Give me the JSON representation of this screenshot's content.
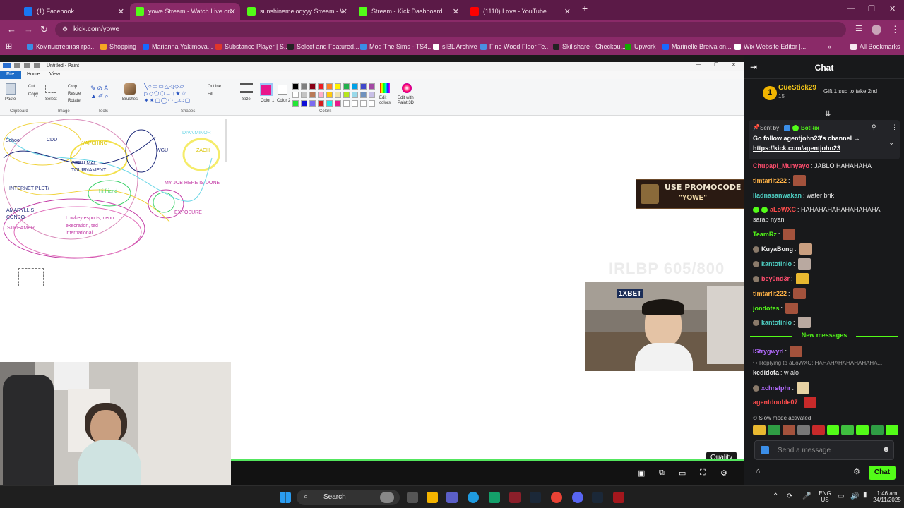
{
  "browser": {
    "tabs": [
      {
        "label": "(1) Facebook",
        "color": "#1877f2",
        "active": false
      },
      {
        "label": "yowe Stream - Watch Live on K",
        "color": "#53fc18",
        "active": true
      },
      {
        "label": "sunshinemelodyyy Stream - W",
        "color": "#53fc18",
        "active": false
      },
      {
        "label": "Stream - Kick Dashboard",
        "color": "#53fc18",
        "active": false
      },
      {
        "label": "(1110) Love - YouTube",
        "color": "#ff0000",
        "active": false
      }
    ],
    "url": "kick.com/yowe",
    "bookmarks": [
      "Компьютерная гра...",
      "Shopping",
      "Marianna Yakimova...",
      "Substance Player | S...",
      "Select and Featured...",
      "Mod The Sims - TS4...",
      "sIBL Archive",
      "Fine Wood Floor Te...",
      "Skillshare - Checkou...",
      "Upwork",
      "Marinelle Breiva on...",
      "Wix Website Editor |..."
    ],
    "all_bookmarks": "All Bookmarks"
  },
  "paint": {
    "title": "Untitled - Paint",
    "menu": {
      "file": "File",
      "home": "Home",
      "view": "View"
    },
    "ribbon": {
      "paste": "Paste",
      "cut": "Cut",
      "copy": "Copy",
      "clipboard": "Clipboard",
      "select": "Select",
      "crop": "Crop",
      "resize": "Resize",
      "rotate": "Rotate",
      "image": "Image",
      "tools": "Tools",
      "brushes": "Brushes",
      "shapes": "Shapes",
      "outline": "Outline",
      "fill": "Fill",
      "size": "Size",
      "color1": "Color 1",
      "color2": "Color 2",
      "colors": "Colors",
      "edit_colors": "Edit colors",
      "edit_paint3d": "Edit with Paint 3D"
    },
    "canvas_labels": [
      {
        "text": "School",
        "color": "#1e2a7a"
      },
      {
        "text": "CDD",
        "color": "#1e2a7a"
      },
      {
        "text": "YAPCHING",
        "color": "#d9c300"
      },
      {
        "text": "CEBU MALL",
        "color": "#1e2a7a"
      },
      {
        "text": "TOURNAMENT",
        "color": "#1e2a7a"
      },
      {
        "text": "WGU",
        "color": "#1e2a7a"
      },
      {
        "text": "ZACH",
        "color": "#d9c300"
      },
      {
        "text": "INTERNET PLDT/",
        "color": "#1e2a7a"
      },
      {
        "text": "Hi friend",
        "color": "#3dd26a"
      },
      {
        "text": "MY JOB HERE IS DONE",
        "color": "#c23aa5"
      },
      {
        "text": "AMARYLLIS",
        "color": "#1e2a7a"
      },
      {
        "text": "CONDO",
        "color": "#1e2a7a"
      },
      {
        "text": "STREAMER",
        "color": "#c23aa5"
      },
      {
        "text": "Lowkey esports, neon",
        "color": "#c23aa5"
      },
      {
        "text": "execration, ted",
        "color": "#c23aa5"
      },
      {
        "text": "international",
        "color": "#c23aa5"
      },
      {
        "text": "EXPOSURE",
        "color": "#c23aa5"
      },
      {
        "text": "DIVA MINOR",
        "color": "#67d5e6"
      }
    ]
  },
  "stream": {
    "promo_line1": "USE PROMOCODE",
    "promo_line2": "\"YOWE\"",
    "watermark": "IRLBP 605/800",
    "sponsor": "1XBET",
    "quality": "Quality",
    "progress": 1.0
  },
  "chat": {
    "title": "Chat",
    "gift": {
      "user": "CueStick29",
      "count": "15",
      "text": "Gift 1 sub to take 2nd"
    },
    "pinned": {
      "sent_by_label": "Sent by",
      "sender": "BotRix",
      "text": "Go follow agentjohn23's channel →",
      "link": "https://kick.com/agentjohn23"
    },
    "messages": [
      {
        "user": "Chupapi_Munyayo",
        "color": "#ff4d6d",
        "text": "JABLO HAHAHAHA",
        "emote": false
      },
      {
        "user": "timtarlit222",
        "color": "#ffb347",
        "text": "",
        "emote": true
      },
      {
        "user": "lladnasanwakan",
        "color": "#4fd1c5",
        "text": "water brik",
        "emote": false
      },
      {
        "user": "aLoWXC",
        "color": "#ff4d4d",
        "text": "HAHAHAHAHAHAHAHAHA",
        "emote": false
      },
      {
        "user": "",
        "color": "#e8e8e8",
        "text": "sarap nyan",
        "emote": false
      },
      {
        "user": "TeamRz",
        "color": "#53fc18",
        "text": "",
        "emote": true
      },
      {
        "user": "KuyaBong",
        "color": "#e8e8e8",
        "text": "",
        "emote": true
      },
      {
        "user": "kantotinio",
        "color": "#4fd1c5",
        "text": "",
        "emote": true
      },
      {
        "user": "bey0nd3r",
        "color": "#ff4d6d",
        "text": "",
        "emote": true
      },
      {
        "user": "timtarlit222",
        "color": "#ffb347",
        "text": "",
        "emote": true
      },
      {
        "user": "jondotes",
        "color": "#53fc18",
        "text": "",
        "emote": true
      },
      {
        "user": "kantotinio",
        "color": "#4fd1c5",
        "text": "",
        "emote": true
      }
    ],
    "new_messages": "New messages",
    "after": [
      {
        "user": "lStrygwyrl",
        "color": "#b36bff",
        "text": "",
        "emote": true
      },
      {
        "user": "",
        "color": "#9a9a9a",
        "text": "Replying to aLoWXC: HAHAHAHAHAHAHAHA...",
        "emote": false
      },
      {
        "user": "kedidota",
        "color": "#e8e8e8",
        "text": "w alo",
        "emote": false
      },
      {
        "user": "xchrstphr",
        "color": "#b36bff",
        "text": "",
        "emote": true
      },
      {
        "user": "agentdouble07",
        "color": "#ff4d4d",
        "text": "",
        "emote": true
      }
    ],
    "slow_mode": "Slow mode activated",
    "placeholder": "Send a message",
    "send_button": "Chat"
  },
  "taskbar": {
    "search": "Search",
    "lang": "ENG",
    "region": "US",
    "time": "1:46 am",
    "date": "24/11/2025"
  }
}
